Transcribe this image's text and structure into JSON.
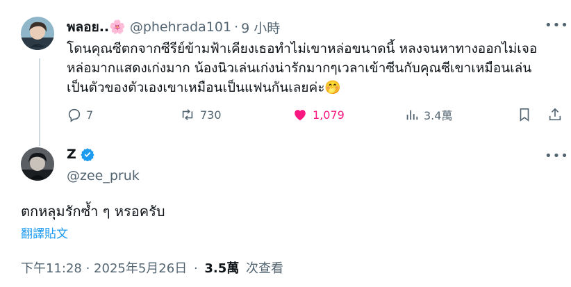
{
  "parent_tweet": {
    "display_name": "พลอย..🌸",
    "handle": "@phehrada101",
    "separator": "·",
    "time": "9 小時",
    "more_label": "•••",
    "text_lines": [
      "โดนคุณซีตกจากซีรีย์ข้ามฟ้าเคียงเธอทำไม่เขาหล่อขนาดนี้ หลงจนหาทางออกไม่เจอ",
      "หล่อมากแสดงเก่งมาก น้องนิวเล่นเก่งน่ารักมากๆเวลาเข้าซีนกับคุณซีเขาเหมือนเล่น",
      "เป็นตัวของตัวเองเขาเหมือนเป็นแฟนกันเลยค่ะ🤭"
    ],
    "actions": {
      "reply_count": "7",
      "retweet_count": "730",
      "like_count": "1,079",
      "view_count": "3.4萬"
    },
    "icons": [
      "reply-icon",
      "retweet-icon",
      "heart-icon",
      "views-icon",
      "bookmark-icon",
      "share-icon"
    ]
  },
  "reply_tweet": {
    "display_name": "Z",
    "verified": true,
    "handle": "@zee_pruk",
    "more_label": "•••",
    "text": "ตกหลุมรักซ้ำ ๆ หรอครับ",
    "translate_label": "翻譯貼文",
    "timestamp": "下午11:28 · 2025年5月26日",
    "meta_separator": "·",
    "views_count": "3.5萬",
    "views_label": "次查看"
  },
  "colors": {
    "text_primary": "#0f1419",
    "text_secondary": "#536471",
    "like_pink": "#f91880",
    "verified_blue": "#1d9bf0",
    "link_blue": "#1d9bf0",
    "thread_line": "#cfd9de"
  }
}
